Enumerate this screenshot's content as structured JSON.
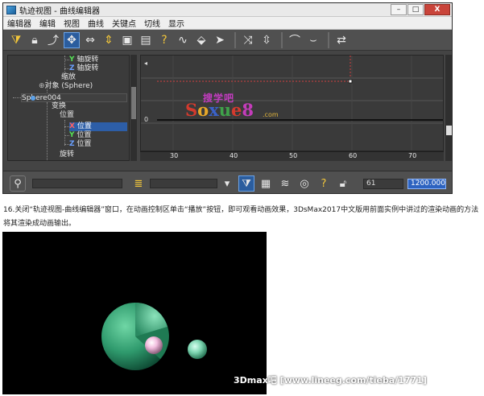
{
  "track_view": {
    "title": "轨迹视图 - 曲线编辑器",
    "menu": [
      "编辑器",
      "编辑",
      "视图",
      "曲线",
      "关键点",
      "切线",
      "显示"
    ],
    "window_buttons": [
      "–",
      "□",
      "X"
    ],
    "toolbar_icons": [
      "filter-icon",
      "lock-icon",
      "snap-icon",
      "move-key-icon",
      "slide-icon",
      "scale-keys-icon",
      "region-icon",
      "retime-icon",
      "add-key-icon",
      "draw-curve-icon",
      "reduce-icon",
      "select-icon",
      "tangent-icon",
      "ease-icon",
      "break-tangent-icon",
      "unify-tangent-icon"
    ],
    "tree": [
      {
        "label": "Y 轴旋转",
        "axis": "Y",
        "rest": " 轴旋转"
      },
      {
        "label": "Z 轴旋转",
        "axis": "Z",
        "rest": " 轴旋转"
      },
      {
        "label": "缩放",
        "axis": "",
        "rest": "缩放"
      },
      {
        "label": "对象 (Sphere)",
        "axis": "",
        "rest": "对象 (Sphere)"
      },
      {
        "label": "Sphere004",
        "axis": "",
        "rest": "Sphere004"
      },
      {
        "label": "变换",
        "axis": "",
        "rest": "变换"
      },
      {
        "label": "位置",
        "axis": "",
        "rest": "位置"
      },
      {
        "label": "X 位置",
        "axis": "X",
        "rest": " 位置"
      },
      {
        "label": "Y 位置",
        "axis": "Y",
        "rest": " 位置"
      },
      {
        "label": "Z 位置",
        "axis": "Z",
        "rest": " 位置"
      },
      {
        "label": "旋转",
        "axis": "",
        "rest": "旋转"
      }
    ],
    "curve": {
      "y_label_zero": "0",
      "ruler_labels": [
        "30",
        "40",
        "50",
        "60",
        "70"
      ]
    },
    "status": {
      "frame_current": "61",
      "frame_value": "1200.000"
    },
    "watermark": {
      "line1": "搜学吧",
      "line2_parts": [
        "S",
        "o",
        "x",
        "u",
        "e",
        "8"
      ],
      "line3": ".com"
    }
  },
  "caption": "16.关闭“轨迹视图-曲线编辑器”窗口，在动画控制区单击“播放”按钮，即可观看动画效果，3DsMax2017中文版用前面实例中讲过的渲染动画的方法将其渲染成动画输出。",
  "render": {
    "watermark": "3Dmax吧 [www.lineeg.com/tieba/1771]",
    "colors": {
      "big_sphere": "#2f9a6d",
      "pink_ball": "#f3bfe0",
      "green_ball": "#7ed6b2"
    }
  }
}
